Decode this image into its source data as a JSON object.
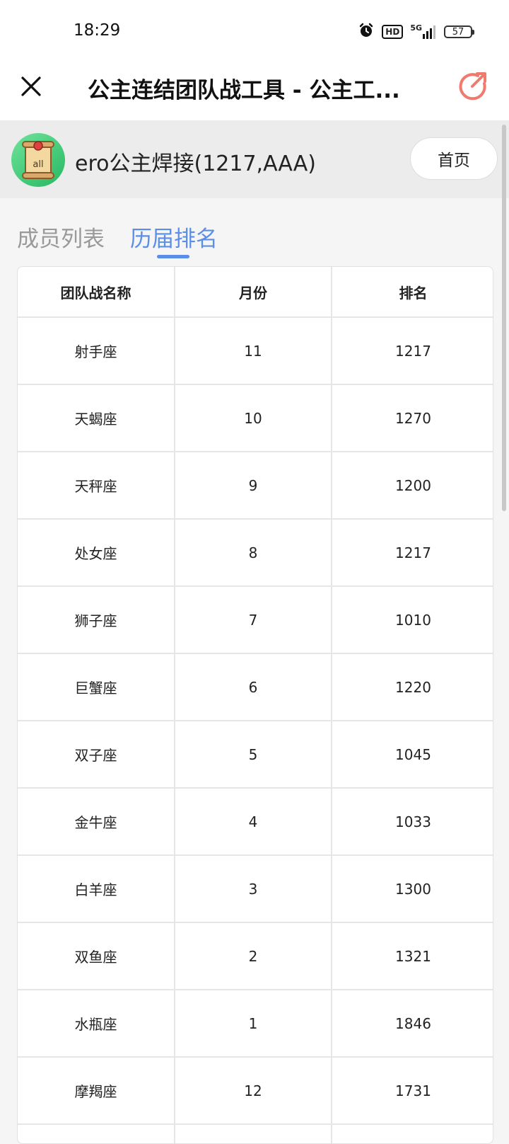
{
  "status": {
    "time": "18:29",
    "hd": "HD",
    "network": "5G",
    "battery": "57"
  },
  "nav": {
    "title": "公主连结团队战工具 - 公主工..."
  },
  "guild": {
    "avatar_text": "all",
    "name": "ero公主焊接(1217,AAA)",
    "home_label": "首页"
  },
  "tabs": [
    {
      "label": "成员列表",
      "active": false
    },
    {
      "label": "历届排名",
      "active": true
    }
  ],
  "table": {
    "headers": [
      "团队战名称",
      "月份",
      "排名"
    ],
    "rows": [
      {
        "name": "射手座",
        "month": "11",
        "rank": "1217"
      },
      {
        "name": "天蝎座",
        "month": "10",
        "rank": "1270"
      },
      {
        "name": "天秤座",
        "month": "9",
        "rank": "1200"
      },
      {
        "name": "处女座",
        "month": "8",
        "rank": "1217"
      },
      {
        "name": "狮子座",
        "month": "7",
        "rank": "1010"
      },
      {
        "name": "巨蟹座",
        "month": "6",
        "rank": "1220"
      },
      {
        "name": "双子座",
        "month": "5",
        "rank": "1045"
      },
      {
        "name": "金牛座",
        "month": "4",
        "rank": "1033"
      },
      {
        "name": "白羊座",
        "month": "3",
        "rank": "1300"
      },
      {
        "name": "双鱼座",
        "month": "2",
        "rank": "1321"
      },
      {
        "name": "水瓶座",
        "month": "1",
        "rank": "1846"
      },
      {
        "name": "摩羯座",
        "month": "12",
        "rank": "1731"
      },
      {
        "name": "",
        "month": "",
        "rank": ""
      }
    ]
  },
  "colors": {
    "accent": "#5b8ee6",
    "share": "#f07a6e",
    "avatar": "#3cc876"
  }
}
